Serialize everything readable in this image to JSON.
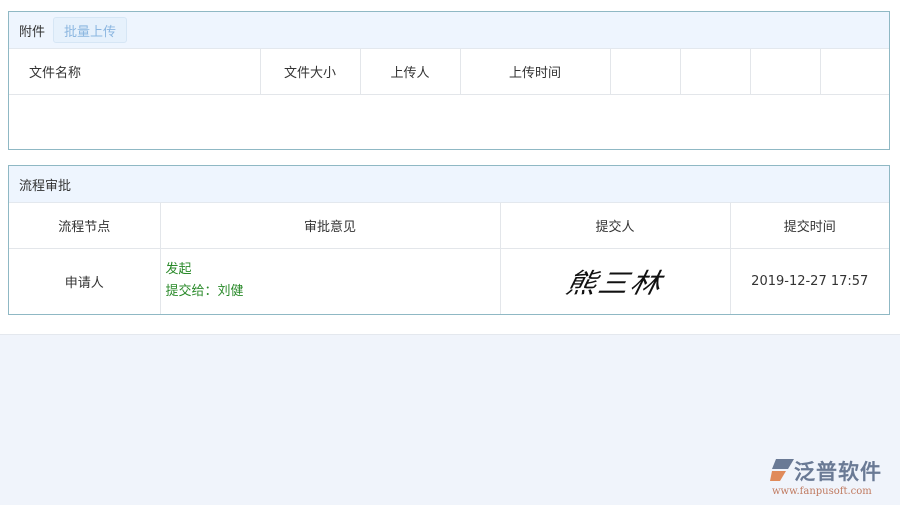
{
  "attachments": {
    "title": "附件",
    "upload_button": "批量上传",
    "columns": [
      "文件名称",
      "文件大小",
      "上传人",
      "上传时间",
      "",
      "",
      "",
      ""
    ]
  },
  "approval": {
    "title": "流程审批",
    "columns": [
      "流程节点",
      "审批意见",
      "提交人",
      "提交时间"
    ],
    "rows": [
      {
        "node": "申请人",
        "opinion_line1": "发起",
        "opinion_line2": "提交给：刘健",
        "submitter_signature": "熊三林",
        "time": "2019-12-27 17:57"
      }
    ]
  },
  "logo": {
    "name": "泛普软件",
    "url": "www.fanpusoft.com"
  }
}
